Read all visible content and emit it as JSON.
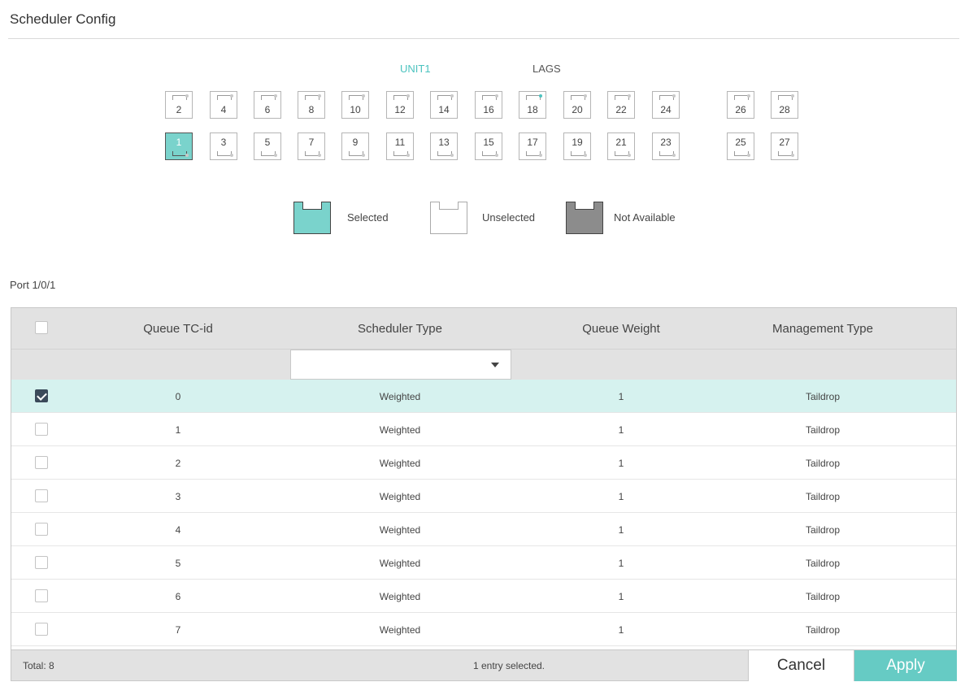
{
  "panel": {
    "title": "Scheduler Config"
  },
  "tabs": {
    "unit": "UNIT1",
    "lags": "LAGS"
  },
  "ports": {
    "top": [
      "2",
      "4",
      "6",
      "8",
      "10",
      "12",
      "14",
      "16",
      "18",
      "20",
      "22",
      "24",
      "26",
      "28"
    ],
    "bottom": [
      "1",
      "3",
      "5",
      "7",
      "9",
      "11",
      "13",
      "15",
      "17",
      "19",
      "21",
      "23",
      "25",
      "27"
    ],
    "selected": "1",
    "active_led": "18"
  },
  "legend": {
    "selected": "Selected",
    "unselected": "Unselected",
    "not_available": "Not Available"
  },
  "port_label": "Port 1/0/1",
  "table": {
    "headers": [
      "Queue TC-id",
      "Scheduler Type",
      "Queue Weight",
      "Management Type"
    ],
    "filter_scheduler_type": "",
    "rows": [
      {
        "checked": true,
        "tc": "0",
        "type": "Weighted",
        "weight": "1",
        "mgmt": "Taildrop"
      },
      {
        "checked": false,
        "tc": "1",
        "type": "Weighted",
        "weight": "1",
        "mgmt": "Taildrop"
      },
      {
        "checked": false,
        "tc": "2",
        "type": "Weighted",
        "weight": "1",
        "mgmt": "Taildrop"
      },
      {
        "checked": false,
        "tc": "3",
        "type": "Weighted",
        "weight": "1",
        "mgmt": "Taildrop"
      },
      {
        "checked": false,
        "tc": "4",
        "type": "Weighted",
        "weight": "1",
        "mgmt": "Taildrop"
      },
      {
        "checked": false,
        "tc": "5",
        "type": "Weighted",
        "weight": "1",
        "mgmt": "Taildrop"
      },
      {
        "checked": false,
        "tc": "6",
        "type": "Weighted",
        "weight": "1",
        "mgmt": "Taildrop"
      },
      {
        "checked": false,
        "tc": "7",
        "type": "Weighted",
        "weight": "1",
        "mgmt": "Taildrop"
      }
    ],
    "total": "Total: 8",
    "selection_status": "1 entry selected."
  },
  "buttons": {
    "cancel": "Cancel",
    "apply": "Apply"
  },
  "colors": {
    "accent": "#4cc3bf",
    "selected_row": "#d6f2ef",
    "apply": "#66cbc4",
    "header_bg": "#e2e2e2"
  }
}
